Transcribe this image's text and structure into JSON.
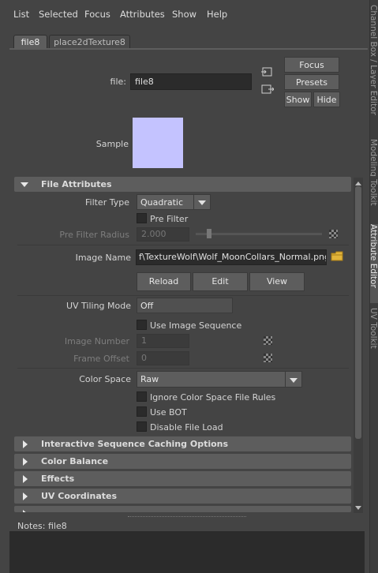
{
  "menu": [
    "List",
    "Selected",
    "Focus",
    "Attributes",
    "Show",
    "Help"
  ],
  "side_tabs": [
    "Channel Box / Layer Editor",
    "Modeling Toolkit",
    "Attribute Editor",
    "UV Toolkit"
  ],
  "node_tabs": [
    "file8",
    "place2dTexture8"
  ],
  "file_field": {
    "label": "file:",
    "value": "file8"
  },
  "buttons": {
    "focus": "Focus",
    "presets": "Presets",
    "show": "Show",
    "hide": "Hide"
  },
  "sample_label": "Sample",
  "colors": {
    "sample_swatch": "#c4c3ff",
    "background": "#444444",
    "section": "#5d5d5d"
  },
  "file_attributes": {
    "title": "File Attributes",
    "filter_type": {
      "label": "Filter Type",
      "value": "Quadratic"
    },
    "pre_filter": "Pre Filter",
    "pre_filter_radius": {
      "label": "Pre Filter Radius",
      "value": "2.000"
    },
    "image_name": {
      "label": "Image Name",
      "value": "f\\TextureWolf\\Wolf_MoonCollars_Normal.png"
    },
    "reload": "Reload",
    "edit": "Edit",
    "view": "View",
    "uv_tiling_mode": {
      "label": "UV Tiling Mode",
      "value": "Off"
    },
    "use_image_sequence": "Use Image Sequence",
    "image_number": {
      "label": "Image Number",
      "value": "1"
    },
    "frame_offset": {
      "label": "Frame Offset",
      "value": "0"
    },
    "color_space": {
      "label": "Color Space",
      "value": "Raw"
    },
    "ignore_color_space": "Ignore Color Space File Rules",
    "use_bot": "Use BOT",
    "disable_file_load": "Disable File Load"
  },
  "collapsed_sections": [
    "Interactive Sequence Caching Options",
    "Color Balance",
    "Effects",
    "UV Coordinates"
  ],
  "notes": {
    "label": "Notes:",
    "value": "file8"
  }
}
